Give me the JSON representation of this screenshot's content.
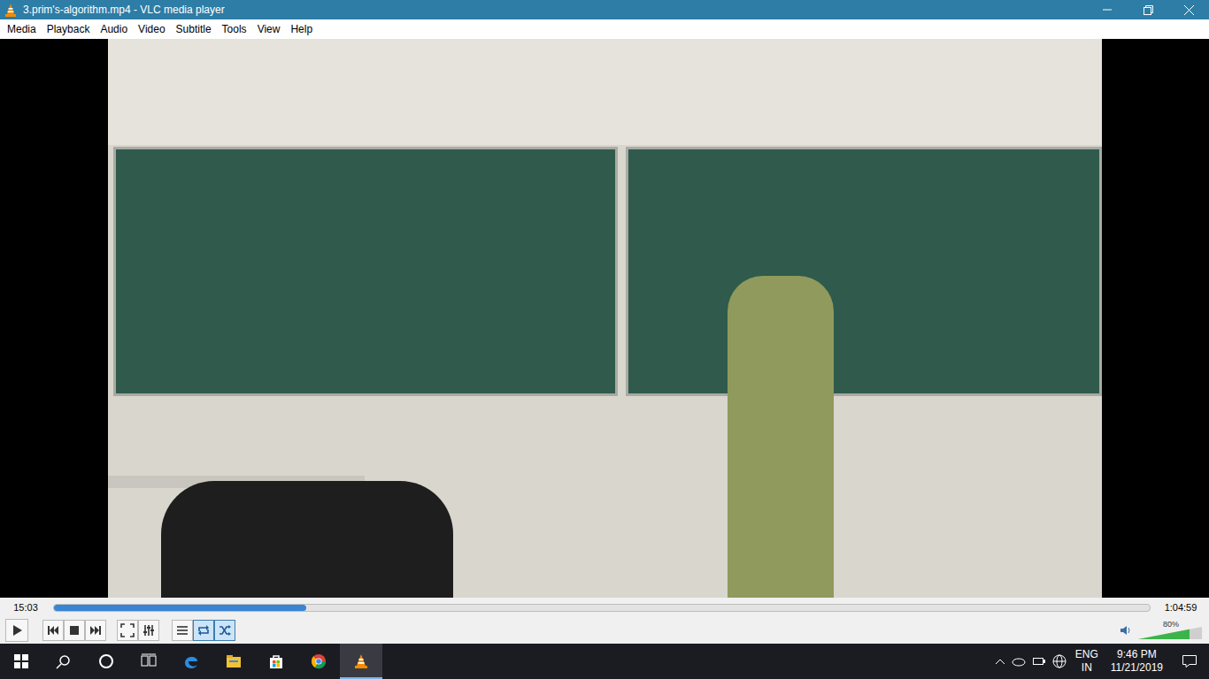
{
  "window": {
    "title": "3.prim's-algorithm.mp4 - VLC media player"
  },
  "menu": [
    "Media",
    "Playback",
    "Audio",
    "Video",
    "Subtitle",
    "Tools",
    "View",
    "Help"
  ],
  "player": {
    "elapsed": "15:03",
    "total": "1:04:59",
    "level": 0.23
  },
  "buttons": [
    {
      "kind": "play",
      "selected": false
    },
    {
      "kind": "prev",
      "selected": false
    },
    {
      "kind": "stop",
      "selected": false
    },
    {
      "kind": "next",
      "selected": false
    },
    {
      "kind": "fullscreen",
      "selected": false
    },
    {
      "kind": "extended",
      "selected": false
    },
    {
      "kind": "playlist",
      "selected": false
    },
    {
      "kind": "loop",
      "selected": true
    },
    {
      "kind": "random",
      "selected": true
    }
  ],
  "volume": {
    "level": 0.8,
    "reading": "80%"
  },
  "taskbar": {
    "apps": [
      {
        "kind": "search",
        "active": false
      },
      {
        "kind": "cortana",
        "active": false
      },
      {
        "kind": "taskview",
        "active": false
      },
      {
        "kind": "edge",
        "active": false
      },
      {
        "kind": "explorer",
        "active": false
      },
      {
        "kind": "store",
        "active": false
      },
      {
        "kind": "chrome",
        "active": false
      },
      {
        "kind": "vlc",
        "active": true
      }
    ],
    "language": [
      "ENG",
      "IN"
    ],
    "time": "9:46 PM",
    "date": "11/21/2019"
  }
}
